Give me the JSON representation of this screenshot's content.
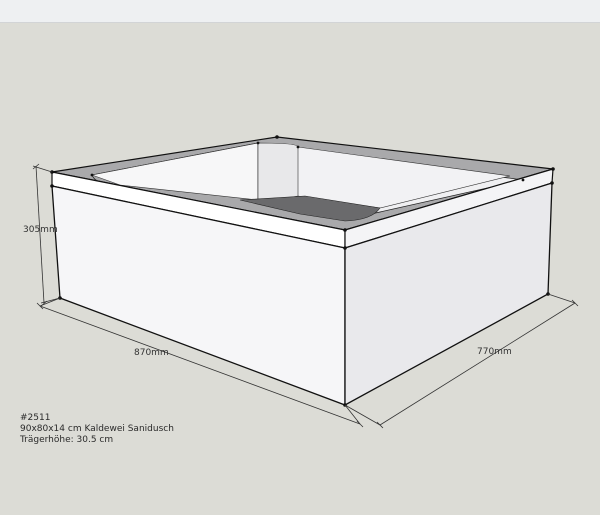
{
  "dimensions": {
    "height_label": "305mm",
    "width_label": "870mm",
    "depth_label": "770mm"
  },
  "info": {
    "id": "#2511",
    "product": "90x80x14 cm Kaldewei Sanidusch",
    "carrier_height": "Trägerhöhe: 30.5 cm"
  },
  "colors": {
    "background": "#dcdcd6",
    "face_light": "#f4f4f6",
    "face_side": "#e4e4e8",
    "rim_top": "#a8a8aa",
    "tray_bottom": "#6a6a6c",
    "edge": "#111111"
  }
}
